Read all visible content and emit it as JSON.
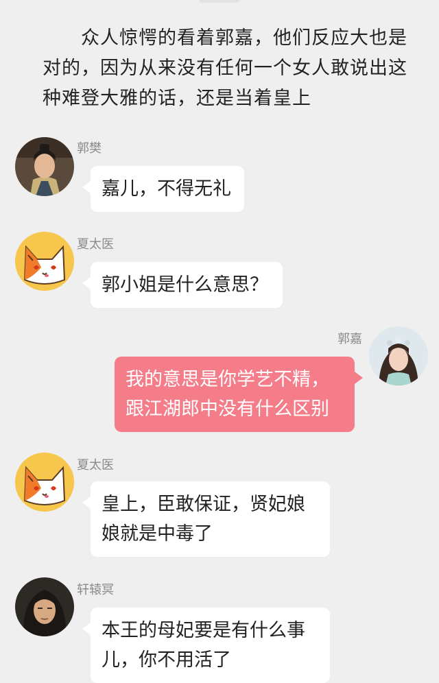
{
  "narration": "众人惊愕的看着郭嘉，他们反应大也是对的，因为从来没有任何一个女人敢说出这种难登大雅的话，还是当着皇上",
  "messages": [
    {
      "sender": "郭樊",
      "side": "left",
      "avatar": "man-portrait",
      "text": "嘉儿，不得无礼"
    },
    {
      "sender": "夏太医",
      "side": "left",
      "avatar": "cartoon-cat",
      "text": "郭小姐是什么意思？"
    },
    {
      "sender": "郭嘉",
      "side": "right",
      "avatar": "woman-portrait",
      "text": "我的意思是你学艺不精，跟江湖郎中没有什么区别"
    },
    {
      "sender": "夏太医",
      "side": "left",
      "avatar": "cartoon-cat",
      "text": "皇上，臣敢保证，贤妃娘娘就是中毒了"
    },
    {
      "sender": "轩辕冥",
      "side": "left",
      "avatar": "man-portrait-2",
      "text": "本王的母妃要是有什么事儿，你不用活了"
    }
  ],
  "colors": {
    "background": "#efefef",
    "left_bubble": "#ffffff",
    "right_bubble": "#f57d8a",
    "sender_name": "#8a8a8a"
  }
}
